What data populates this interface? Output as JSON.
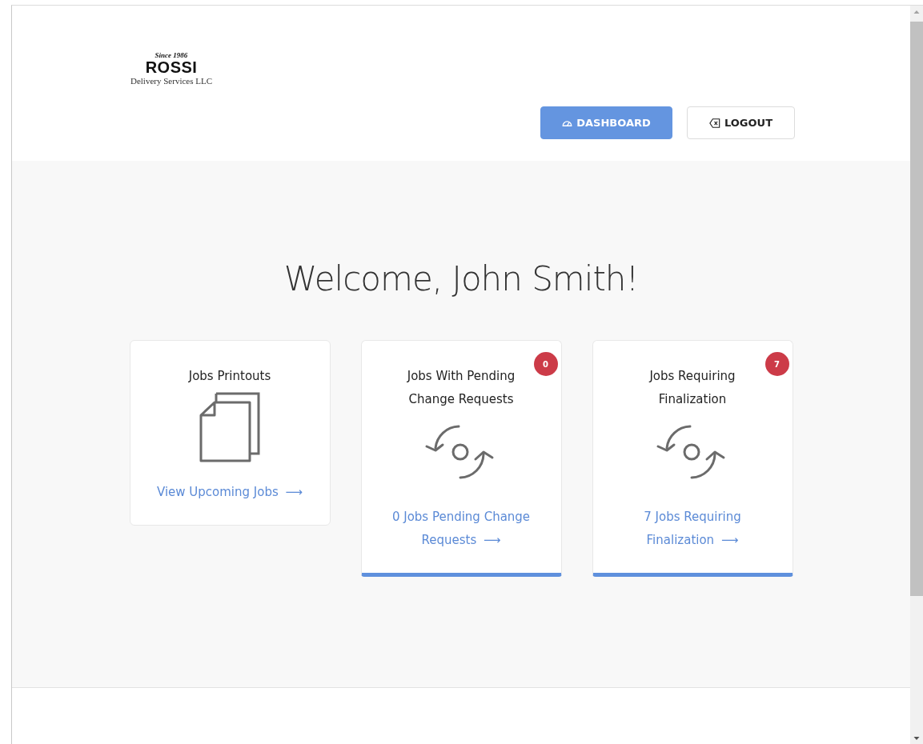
{
  "logo": {
    "tagline": "Since 1986",
    "name": "ROSSI",
    "subtitle": "Delivery Services LLC"
  },
  "nav": [
    {
      "label": "DASHBOARD",
      "kind": "dashboard",
      "selected": true
    },
    {
      "label": "LOGOUT",
      "kind": "logout",
      "selected": false
    }
  ],
  "welcome": "Welcome, John Smith!",
  "cards": [
    {
      "kind": "printouts",
      "title": "Jobs Printouts",
      "link": "View Upcoming Jobs",
      "arrow": "⟶",
      "highlighted": false
    },
    {
      "kind": "cycle",
      "title": "Jobs With Pending Change Requests",
      "badge": "0",
      "link": "0 Jobs Pending Change Requests",
      "arrow": "⟶",
      "highlighted": true
    },
    {
      "kind": "cycle",
      "title": "Jobs Requiring Finalization",
      "badge": "7",
      "link": "7 Jobs Requiring Finalization",
      "arrow": "⟶",
      "highlighted": true
    }
  ]
}
